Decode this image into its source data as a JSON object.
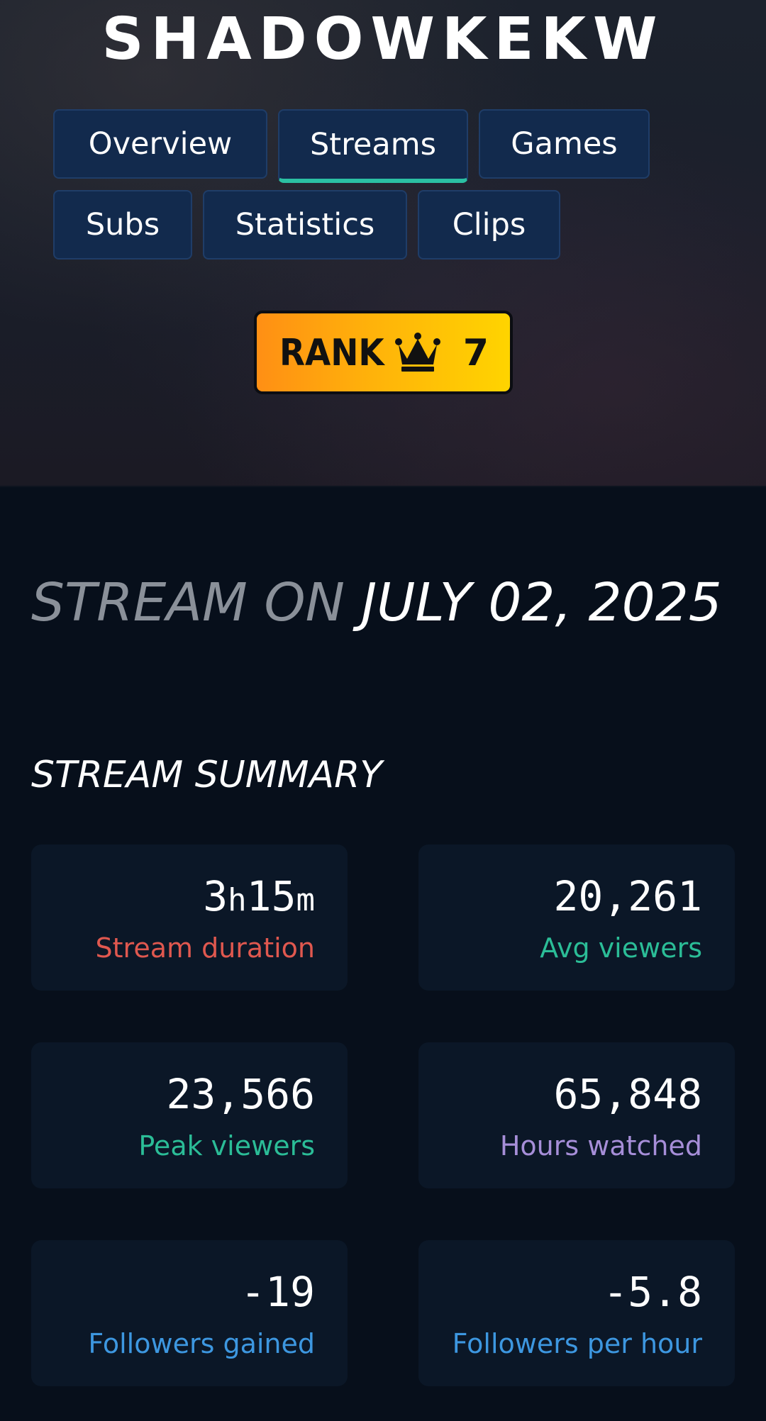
{
  "header": {
    "channel_name": "SHADOWKEKW"
  },
  "tabs": [
    {
      "label": "Overview",
      "active": false
    },
    {
      "label": "Streams",
      "active": true
    },
    {
      "label": "Games",
      "active": false
    },
    {
      "label": "Subs",
      "active": false
    },
    {
      "label": "Statistics",
      "active": false
    },
    {
      "label": "Clips",
      "active": false
    }
  ],
  "rank": {
    "label": "RANK",
    "icon": "crown-icon",
    "value": "7"
  },
  "stream": {
    "prefix": "STREAM ON",
    "date": "JULY 02, 2025"
  },
  "summary": {
    "title": "STREAM SUMMARY",
    "stats": [
      {
        "hours": "3",
        "hours_unit": "h",
        "minutes": "15",
        "minutes_unit": "m",
        "label": "Stream duration",
        "color": "#e0584f"
      },
      {
        "value": "20,261",
        "label": "Avg viewers",
        "color": "#2bbd97"
      },
      {
        "value": "23,566",
        "label": "Peak viewers",
        "color": "#2bbd97"
      },
      {
        "value": "65,848",
        "label": "Hours watched",
        "color": "#a68ed8"
      },
      {
        "value": "-19",
        "label": "Followers gained",
        "color": "#3d97e0"
      },
      {
        "value": "-5.8",
        "label": "Followers per hour",
        "color": "#3d97e0"
      }
    ]
  },
  "colors": {
    "page_background": "#070f1b",
    "card_background": "#0b1727",
    "tab_background": "#122a4d",
    "active_tab_indicator": "#2bc0a3",
    "rank_gradient_start": "#ff8f14",
    "rank_gradient_end": "#ffd400"
  }
}
